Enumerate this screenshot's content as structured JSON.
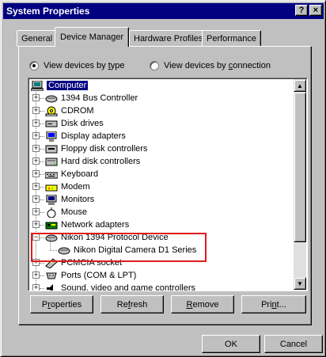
{
  "window": {
    "title": "System Properties",
    "help_glyph": "?",
    "close_glyph": "×"
  },
  "tabs": [
    {
      "label": "General"
    },
    {
      "label": "Device Manager"
    },
    {
      "label": "Hardware Profiles"
    },
    {
      "label": "Performance"
    }
  ],
  "view_options": {
    "by_type": {
      "prefix": "View devices by ",
      "underlined": "t",
      "suffix": "ype",
      "checked": true
    },
    "by_connection": {
      "prefix": "View devices by ",
      "underlined": "c",
      "suffix": "onnection",
      "checked": false
    }
  },
  "tree": {
    "root": "Computer",
    "items": [
      {
        "label": "1394 Bus Controller",
        "icon": "bus-controller-icon"
      },
      {
        "label": "CDROM",
        "icon": "cdrom-icon"
      },
      {
        "label": "Disk drives",
        "icon": "disk-drive-icon"
      },
      {
        "label": "Display adapters",
        "icon": "display-adapter-icon"
      },
      {
        "label": "Floppy disk controllers",
        "icon": "floppy-controller-icon"
      },
      {
        "label": "Hard disk controllers",
        "icon": "hard-disk-controller-icon"
      },
      {
        "label": "Keyboard",
        "icon": "keyboard-icon"
      },
      {
        "label": "Modem",
        "icon": "modem-icon"
      },
      {
        "label": "Monitors",
        "icon": "monitor-icon"
      },
      {
        "label": "Mouse",
        "icon": "mouse-icon"
      },
      {
        "label": "Network adapters",
        "icon": "network-adapter-icon"
      },
      {
        "label": "Nikon 1394 Protocol Device",
        "icon": "protocol-device-icon",
        "expanded": true
      },
      {
        "label": "Nikon Digital Camera D1 Series",
        "icon": "camera-device-icon",
        "child": true
      },
      {
        "label": "PCMCIA socket",
        "icon": "pcmcia-icon"
      },
      {
        "label": "Ports (COM & LPT)",
        "icon": "ports-icon"
      },
      {
        "label": "Sound, video and game controllers",
        "icon": "sound-icon"
      }
    ]
  },
  "buttons": {
    "properties": {
      "prefix": "P",
      "underlined": "r",
      "suffix": "operties"
    },
    "refresh": {
      "prefix": "Re",
      "underlined": "f",
      "suffix": "resh"
    },
    "remove": {
      "prefix": "",
      "underlined": "R",
      "suffix": "emove"
    },
    "print": {
      "prefix": "Pri",
      "underlined": "n",
      "suffix": "t..."
    },
    "ok": "OK",
    "cancel": "Cancel"
  },
  "colors": {
    "title_bar": "#000080",
    "face": "#c0c0c0",
    "highlight_box": "#e21b1b"
  }
}
